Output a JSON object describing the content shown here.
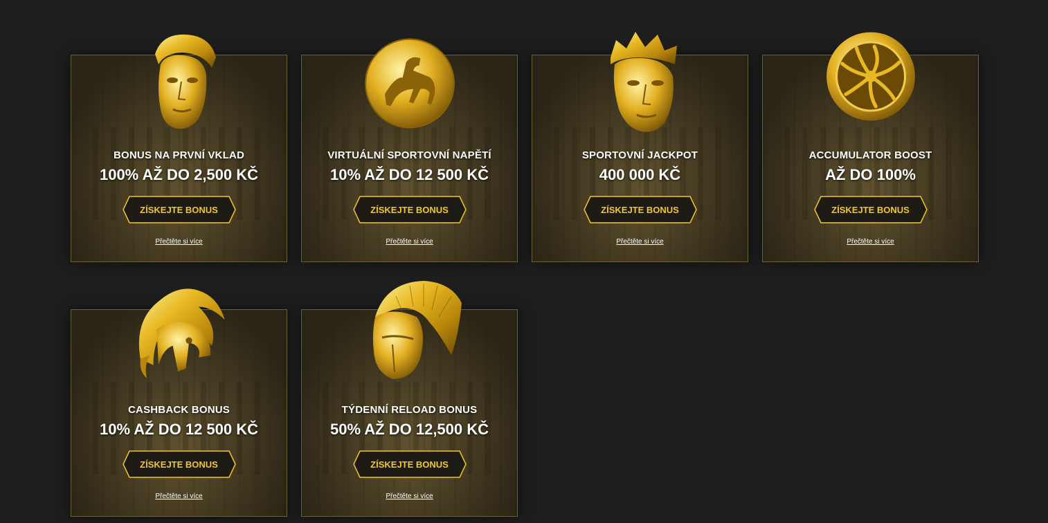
{
  "colors": {
    "background": "#1e1e1e",
    "accent": "#f2c72a",
    "gold": "#d9a91a",
    "border": "#6b5f3e"
  },
  "cards": [
    {
      "icon": "gold-mask-icon",
      "title": "BONUS NA PRVNÍ VKLAD",
      "amount": "100% AŽ DO 2,500 KČ",
      "button": "ZÍSKEJTE BONUS",
      "more": "Přečtěte si více"
    },
    {
      "icon": "gold-horse-coin-icon",
      "title": "VIRTUÁLNÍ SPORTOVNÍ NAPĚTÍ",
      "amount": "10% AŽ DO 12 500 KČ",
      "button": "ZÍSKEJTE BONUS",
      "more": "Přečtěte si více"
    },
    {
      "icon": "gold-crowned-mask-icon",
      "title": "SPORTOVNÍ JACKPOT",
      "amount": "400 000 KČ",
      "button": "ZÍSKEJTE BONUS",
      "more": "Přečtěte si více"
    },
    {
      "icon": "gold-shield-icon",
      "title": "ACCUMULATOR BOOST",
      "amount": "AŽ DO 100%",
      "button": "ZÍSKEJTE BONUS",
      "more": "Přečtěte si více"
    },
    {
      "icon": "gold-helmet-icon",
      "title": "CASHBACK BONUS",
      "amount": "10% AŽ DO 12 500 KČ",
      "button": "ZÍSKEJTE BONUS",
      "more": "Přečtěte si více"
    },
    {
      "icon": "gold-crested-helmet-icon",
      "title": "TÝDENNÍ RELOAD BONUS",
      "amount": "50% AŽ DO 12,500 KČ",
      "button": "ZÍSKEJTE BONUS",
      "more": "Přečtěte si více"
    }
  ]
}
